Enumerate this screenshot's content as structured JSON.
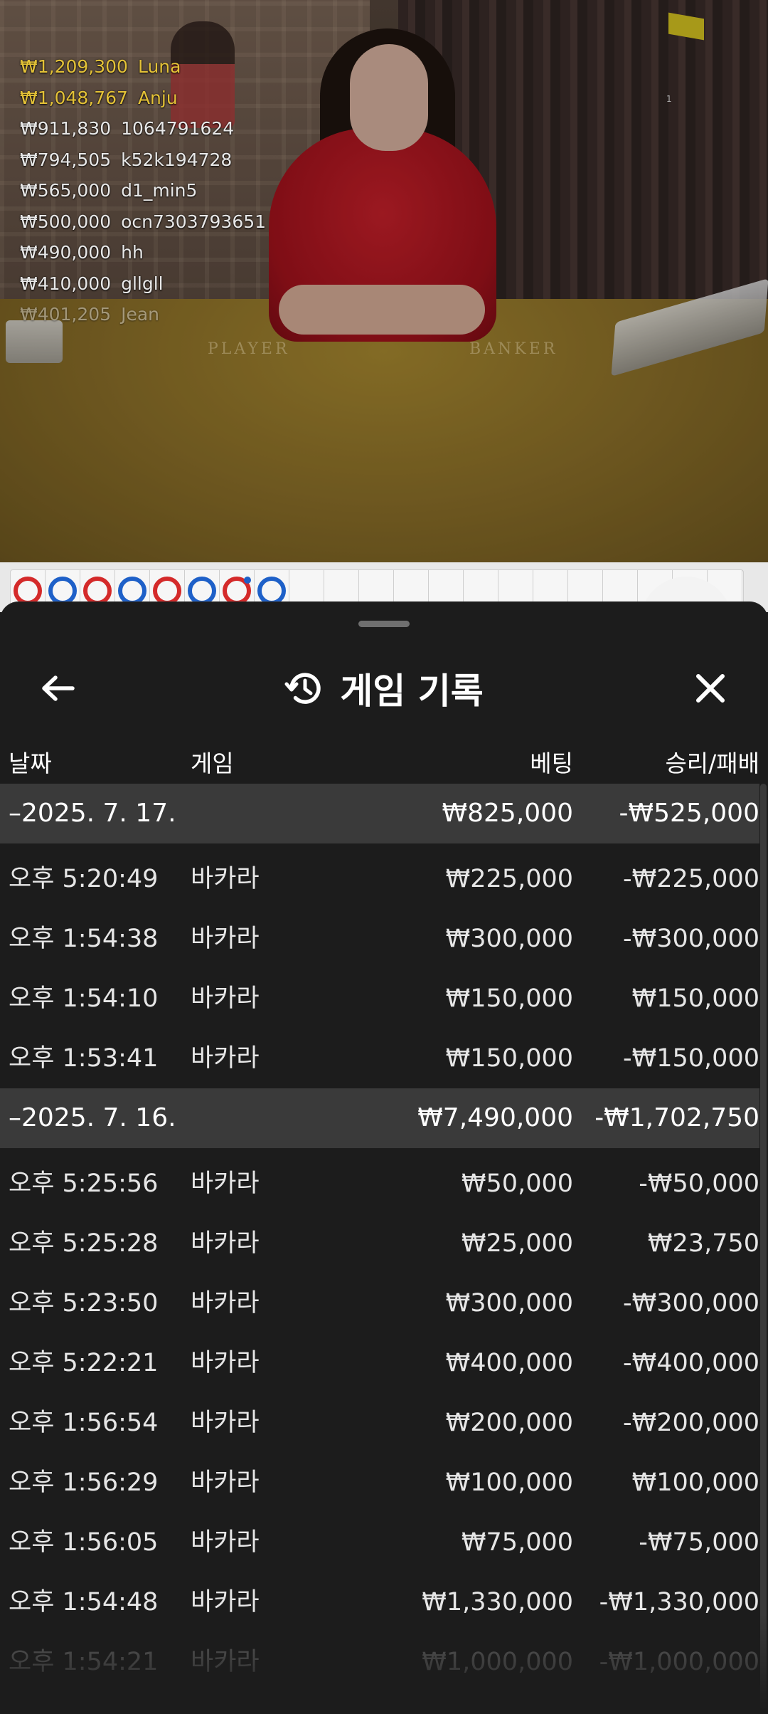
{
  "leaderboard": [
    {
      "amount": "₩1,209,300",
      "name": "Luna"
    },
    {
      "amount": "₩1,048,767",
      "name": "Anju"
    },
    {
      "amount": "₩911,830",
      "name": "1064791624"
    },
    {
      "amount": "₩794,505",
      "name": "k52k194728"
    },
    {
      "amount": "₩565,000",
      "name": "d1_min5"
    },
    {
      "amount": "₩500,000",
      "name": "ocn7303793651"
    },
    {
      "amount": "₩490,000",
      "name": "hh"
    },
    {
      "amount": "₩410,000",
      "name": "gllgll"
    },
    {
      "amount": "₩401,205",
      "name": "Jean"
    }
  ],
  "video": {
    "table_left": "PLAYER",
    "table_right": "BANKER",
    "mini_label": "1"
  },
  "road": {
    "beads": [
      "red",
      "blue",
      "red",
      "blue",
      "red",
      "blue",
      "red-tie",
      "blue"
    ]
  },
  "sheet": {
    "title": "게임 기록",
    "title_icon": "history-icon",
    "back_icon": "arrow-left-icon",
    "close_icon": "close-icon"
  },
  "columns": {
    "date": "날짜",
    "game": "게임",
    "bet": "베팅",
    "result": "승리/패배"
  },
  "records": [
    {
      "date": "–2025. 7. 17.",
      "bet": "₩825,000",
      "result": "-₩525,000",
      "rows": [
        {
          "time": "오후 5:20:49",
          "game": "바카라",
          "bet": "₩225,000",
          "result": "-₩225,000"
        },
        {
          "time": "오후 1:54:38",
          "game": "바카라",
          "bet": "₩300,000",
          "result": "-₩300,000"
        },
        {
          "time": "오후 1:54:10",
          "game": "바카라",
          "bet": "₩150,000",
          "result": "₩150,000"
        },
        {
          "time": "오후 1:53:41",
          "game": "바카라",
          "bet": "₩150,000",
          "result": "-₩150,000"
        }
      ]
    },
    {
      "date": "–2025. 7. 16.",
      "bet": "₩7,490,000",
      "result": "-₩1,702,750",
      "rows": [
        {
          "time": "오후 5:25:56",
          "game": "바카라",
          "bet": "₩50,000",
          "result": "-₩50,000"
        },
        {
          "time": "오후 5:25:28",
          "game": "바카라",
          "bet": "₩25,000",
          "result": "₩23,750"
        },
        {
          "time": "오후 5:23:50",
          "game": "바카라",
          "bet": "₩300,000",
          "result": "-₩300,000"
        },
        {
          "time": "오후 5:22:21",
          "game": "바카라",
          "bet": "₩400,000",
          "result": "-₩400,000"
        },
        {
          "time": "오후 1:56:54",
          "game": "바카라",
          "bet": "₩200,000",
          "result": "-₩200,000"
        },
        {
          "time": "오후 1:56:29",
          "game": "바카라",
          "bet": "₩100,000",
          "result": "₩100,000"
        },
        {
          "time": "오후 1:56:05",
          "game": "바카라",
          "bet": "₩75,000",
          "result": "-₩75,000"
        },
        {
          "time": "오후 1:54:48",
          "game": "바카라",
          "bet": "₩1,330,000",
          "result": "-₩1,330,000"
        },
        {
          "time": "오후 1:54:21",
          "game": "바카라",
          "bet": "₩1,000,000",
          "result": "-₩1,000,000"
        }
      ]
    }
  ]
}
